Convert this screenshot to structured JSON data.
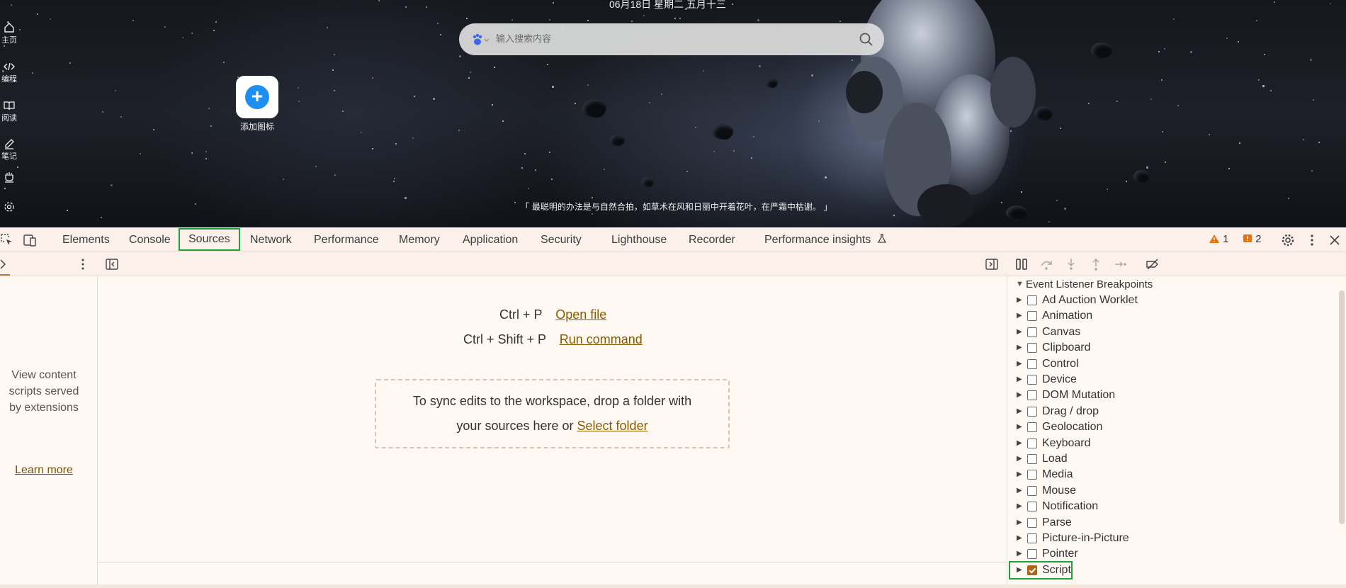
{
  "browser": {
    "date_text": "06月18日 星期二 五月十三",
    "search": {
      "placeholder": "输入搜索内容",
      "engine_icon": "baidu-paw-icon"
    },
    "add_shortcut_label": "添加图标",
    "quote": "「 最聪明的办法是与自然合拍，如草木在风和日丽中开着花叶，在严霜中枯谢。 」",
    "left_rail": [
      {
        "label": "主页",
        "icon": "home-icon"
      },
      {
        "label": "编程",
        "icon": "code-icon"
      },
      {
        "label": "阅读",
        "icon": "book-icon"
      },
      {
        "label": "笔记",
        "icon": "note-icon"
      },
      {
        "label": "",
        "icon": "cup-icon"
      },
      {
        "label": "",
        "icon": "settings-icon"
      }
    ]
  },
  "devtools": {
    "tabs": [
      "Elements",
      "Console",
      "Sources",
      "Network",
      "Performance",
      "Memory",
      "Application",
      "Security",
      "Lighthouse",
      "Recorder",
      "Performance insights"
    ],
    "active_tab": "Sources",
    "issues": {
      "warnings": "1",
      "errors": "2"
    },
    "navigator": {
      "message": "View content scripts served by extensions",
      "learn_more": "Learn more"
    },
    "editor": {
      "open_file_shortcut": "Ctrl + P",
      "open_file_label": "Open file",
      "run_command_shortcut": "Ctrl + Shift + P",
      "run_command_label": "Run command",
      "drop_text_1": "To sync edits to the workspace, drop a folder with",
      "drop_text_2": "your sources here or",
      "select_folder": "Select folder"
    },
    "breakpoints": {
      "header": "Event Listener Breakpoints",
      "items": [
        {
          "label": "Ad Auction Worklet",
          "checked": false
        },
        {
          "label": "Animation",
          "checked": false
        },
        {
          "label": "Canvas",
          "checked": false
        },
        {
          "label": "Clipboard",
          "checked": false
        },
        {
          "label": "Control",
          "checked": false
        },
        {
          "label": "Device",
          "checked": false
        },
        {
          "label": "DOM Mutation",
          "checked": false
        },
        {
          "label": "Drag / drop",
          "checked": false
        },
        {
          "label": "Geolocation",
          "checked": false
        },
        {
          "label": "Keyboard",
          "checked": false
        },
        {
          "label": "Load",
          "checked": false
        },
        {
          "label": "Media",
          "checked": false
        },
        {
          "label": "Mouse",
          "checked": false
        },
        {
          "label": "Notification",
          "checked": false
        },
        {
          "label": "Parse",
          "checked": false
        },
        {
          "label": "Picture-in-Picture",
          "checked": false
        },
        {
          "label": "Pointer",
          "checked": false
        },
        {
          "label": "Script",
          "checked": true
        }
      ]
    }
  }
}
